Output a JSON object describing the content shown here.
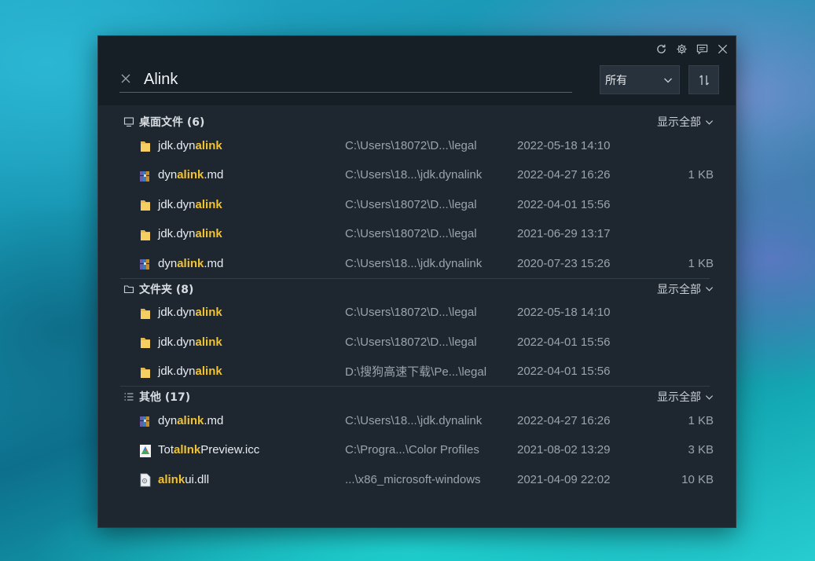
{
  "search": {
    "query": "Alink"
  },
  "filter": {
    "selected": "所有"
  },
  "window_controls": [
    {
      "name": "refresh-icon"
    },
    {
      "name": "gear-icon"
    },
    {
      "name": "feedback-icon"
    },
    {
      "name": "close-icon"
    }
  ],
  "show_all_label": "显示全部",
  "colors": {
    "highlight": "#f1c232",
    "panel": "#1e2730",
    "topbar": "#161e26"
  },
  "sections": [
    {
      "title": "桌面文件 (6)",
      "icon": "desktop-icon",
      "rows": [
        {
          "icon": "folder-icon",
          "pre": "jdk.dyn",
          "hl": "alink",
          "post": "",
          "path": "C:\\Users\\18072\\D...\\legal",
          "date": "2022-05-18 14:10",
          "size": ""
        },
        {
          "icon": "rar-archive-icon",
          "pre": "dyn",
          "hl": "alink",
          "post": ".md",
          "path": "C:\\Users\\18...\\jdk.dynalink",
          "date": "2022-04-27 16:26",
          "size": "1 KB"
        },
        {
          "icon": "folder-icon",
          "pre": "jdk.dyn",
          "hl": "alink",
          "post": "",
          "path": "C:\\Users\\18072\\D...\\legal",
          "date": "2022-04-01 15:56",
          "size": ""
        },
        {
          "icon": "folder-icon",
          "pre": "jdk.dyn",
          "hl": "alink",
          "post": "",
          "path": "C:\\Users\\18072\\D...\\legal",
          "date": "2021-06-29 13:17",
          "size": ""
        },
        {
          "icon": "rar-archive-icon",
          "pre": "dyn",
          "hl": "alink",
          "post": ".md",
          "path": "C:\\Users\\18...\\jdk.dynalink",
          "date": "2020-07-23 15:26",
          "size": "1 KB"
        }
      ]
    },
    {
      "title": "文件夹 (8)",
      "icon": "folder-outline-icon",
      "rows": [
        {
          "icon": "folder-icon",
          "pre": "jdk.dyn",
          "hl": "alink",
          "post": "",
          "path": "C:\\Users\\18072\\D...\\legal",
          "date": "2022-05-18 14:10",
          "size": ""
        },
        {
          "icon": "folder-icon",
          "pre": "jdk.dyn",
          "hl": "alink",
          "post": "",
          "path": "C:\\Users\\18072\\D...\\legal",
          "date": "2022-04-01 15:56",
          "size": ""
        },
        {
          "icon": "folder-icon",
          "pre": "jdk.dyn",
          "hl": "alink",
          "post": "",
          "path": "D:\\搜狗高速下载\\Pe...\\legal",
          "date": "2022-04-01 15:56",
          "size": ""
        }
      ]
    },
    {
      "title": "其他 (17)",
      "icon": "list-icon",
      "rows": [
        {
          "icon": "rar-archive-icon",
          "pre": "dyn",
          "hl": "alink",
          "post": ".md",
          "path": "C:\\Users\\18...\\jdk.dynalink",
          "date": "2022-04-27 16:26",
          "size": "1 KB"
        },
        {
          "icon": "color-profile-icon",
          "pre": "Tot",
          "hl": "alInk",
          "post": "Preview.icc",
          "path": "C:\\Progra...\\Color Profiles",
          "date": "2021-08-02 13:29",
          "size": "3 KB"
        },
        {
          "icon": "dll-file-icon",
          "pre": "",
          "hl": "alink",
          "post": "ui.dll",
          "path": "...\\x86_microsoft-windows",
          "date": "2021-04-09 22:02",
          "size": "10 KB"
        }
      ]
    }
  ]
}
